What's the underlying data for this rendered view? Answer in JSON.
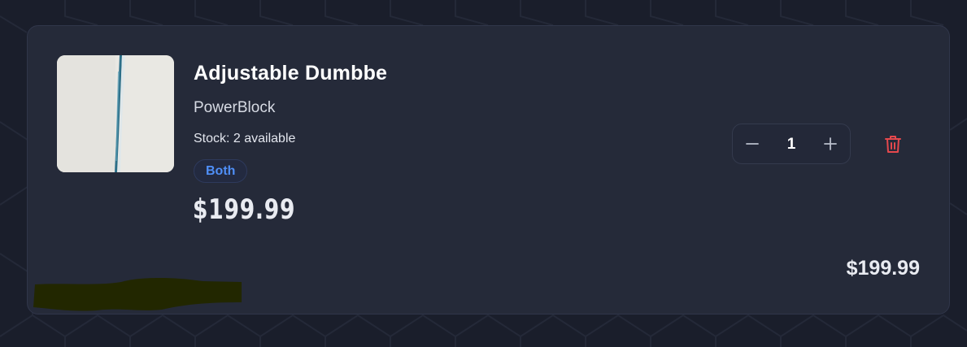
{
  "product": {
    "name": "Adjustable Dumbbe",
    "brand": "PowerBlock",
    "stock_text": "Stock: 2 available",
    "badge": "Both",
    "price": "$199.99",
    "image_icon": "product-photo"
  },
  "quantity": {
    "value": "1",
    "decrement_icon": "minus-icon",
    "increment_icon": "plus-icon"
  },
  "actions": {
    "delete_icon": "trash-icon"
  },
  "line_total": "$199.99",
  "colors": {
    "background": "#1a1e2b",
    "card": "#252a39",
    "badge_text": "#4f8ff7",
    "delete": "#e5484d",
    "redaction": "#222700"
  }
}
